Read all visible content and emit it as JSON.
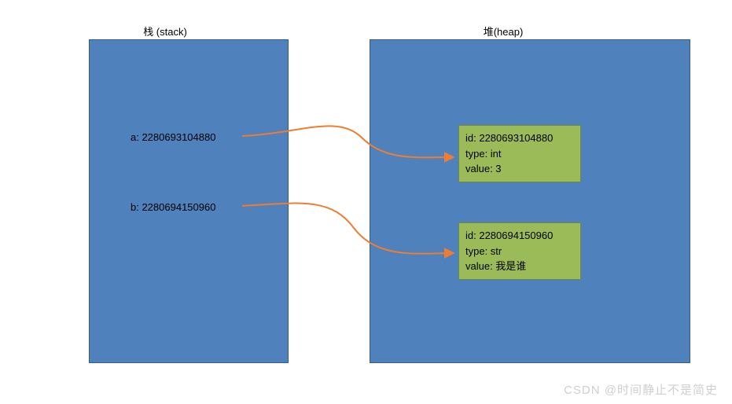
{
  "titles": {
    "stack": "栈 (stack)",
    "heap": "堆(heap)"
  },
  "stack": {
    "a": "a: 2280693104880",
    "b": "b: 2280694150960"
  },
  "heap": {
    "obj1": {
      "id": "id: 2280693104880",
      "type": "type: int",
      "value": "value: 3"
    },
    "obj2": {
      "id": "id: 2280694150960",
      "type": "type: str",
      "value": "value: 我是谁"
    }
  },
  "watermark": "CSDN @时间静止不是简史",
  "colors": {
    "box_fill": "#4f81bd",
    "box_stroke": "#385d8a",
    "obj_fill": "#9bbb59",
    "obj_stroke": "#71893f",
    "arrow": "#ed7d31"
  }
}
